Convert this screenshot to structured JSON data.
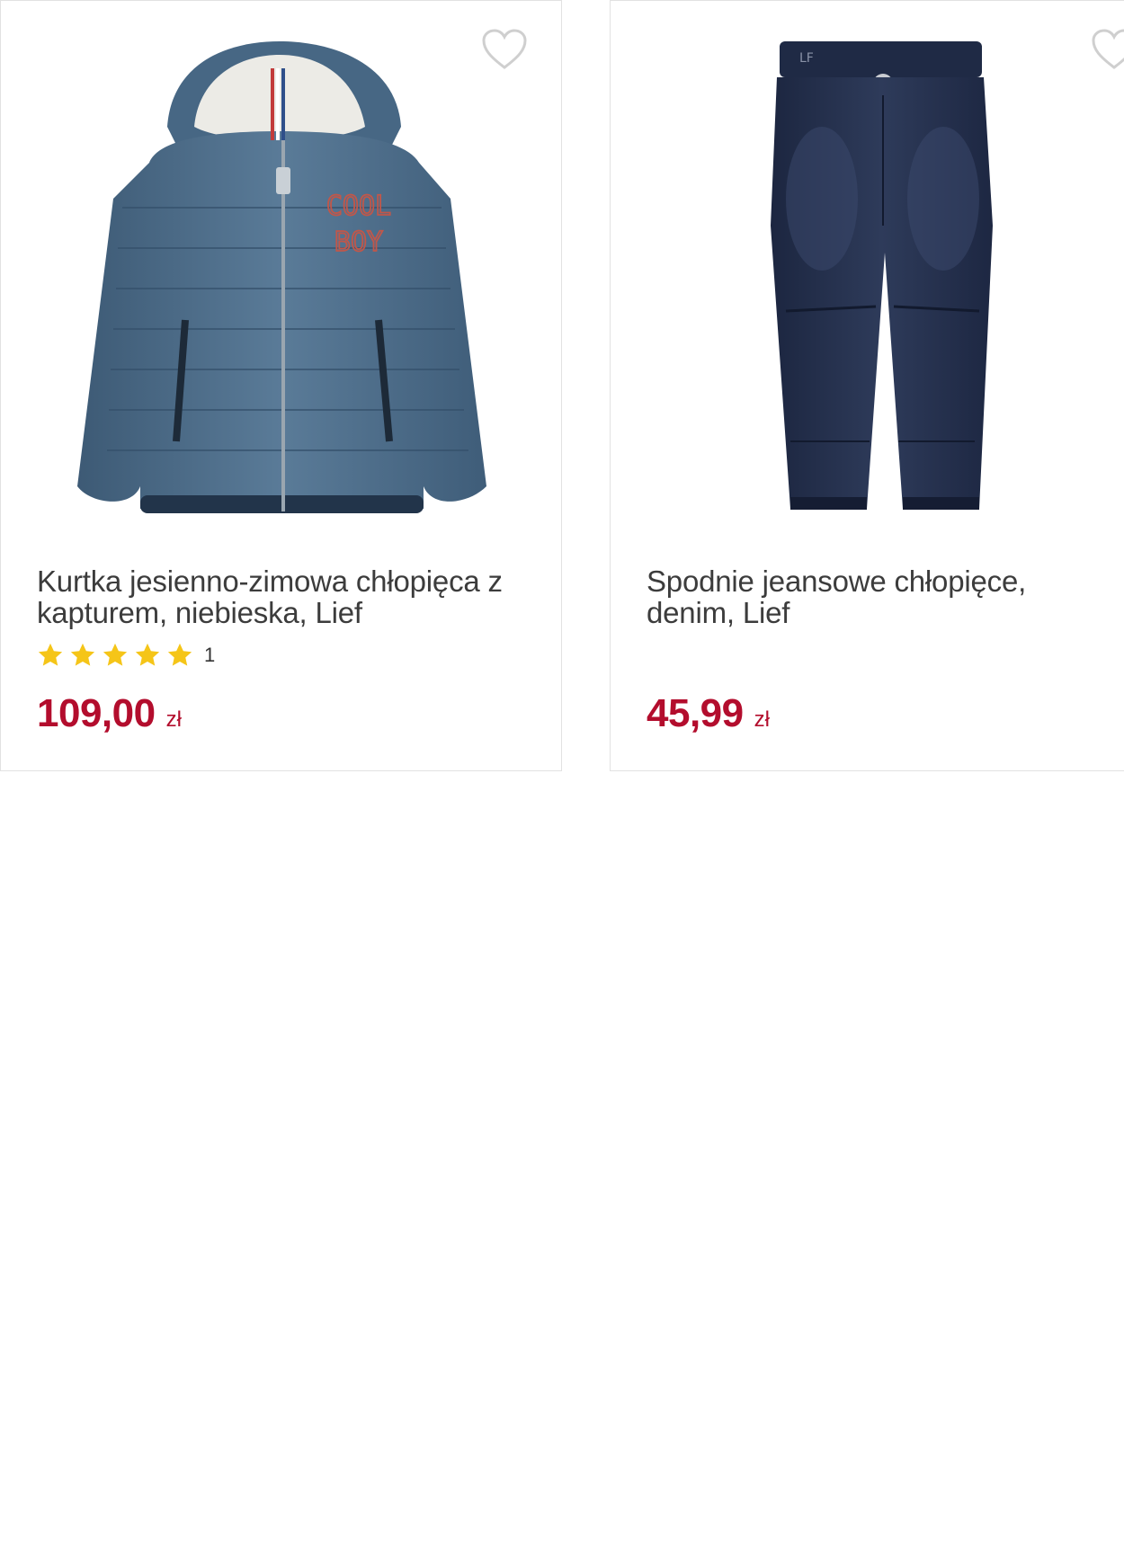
{
  "products": [
    {
      "title": "Kurtka jesienno-zimowa chłopięca z kapturem, niebieska, Lief",
      "rating_stars": 5,
      "rating_count": "1",
      "price": "109,00",
      "currency": "zł",
      "image_icon": "jacket-image",
      "image_print": "COOL BOY"
    },
    {
      "title": "Spodnie jeansowe chłopięce, denim, Lief",
      "price": "45,99",
      "currency": "zł",
      "image_icon": "jeans-image",
      "image_print": "LF"
    }
  ],
  "colors": {
    "price": "#b30d2d",
    "star": "#f5c518",
    "heart_outline": "#cfcfcf",
    "card_border": "#e2e2e2"
  },
  "icons": {
    "favorite": "heart-outline-icon",
    "rating": "star-icon"
  }
}
